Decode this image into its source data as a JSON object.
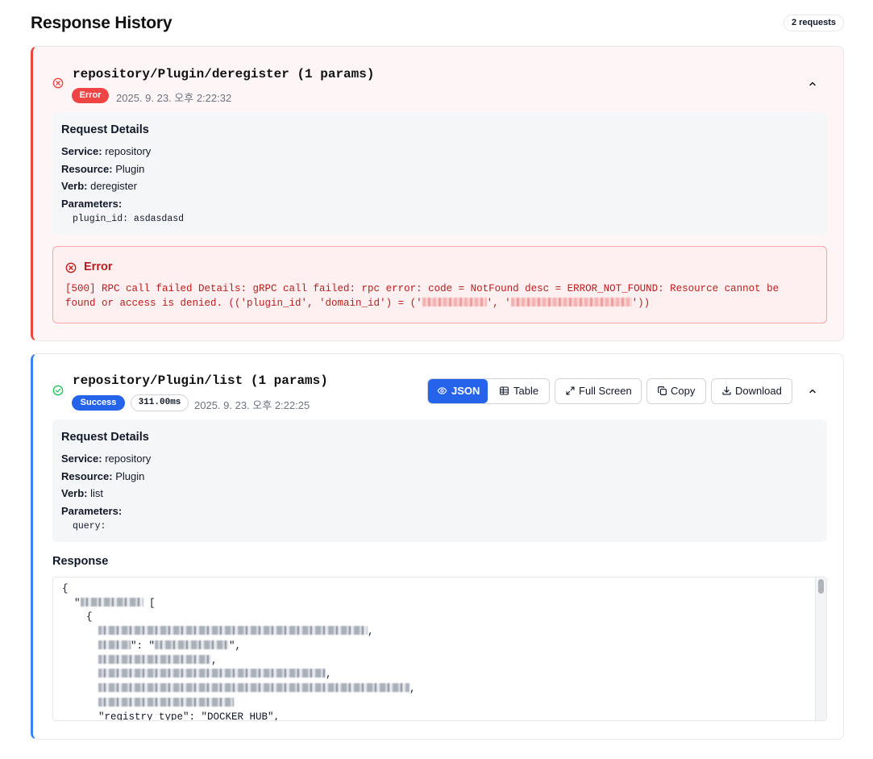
{
  "page": {
    "title": "Response History",
    "request_count": "2 requests"
  },
  "colors": {
    "error": "#ef4444",
    "success": "#2563eb",
    "error_text": "#b91c1c"
  },
  "requests": [
    {
      "title": "repository/Plugin/deregister (1 params)",
      "status": "Error",
      "timestamp": "2025. 9. 23. 오후 2:22:32",
      "details": {
        "heading": "Request Details",
        "service_label": "Service:",
        "service": "repository",
        "resource_label": "Resource:",
        "resource": "Plugin",
        "verb_label": "Verb:",
        "verb": "deregister",
        "parameters_label": "Parameters:",
        "param_key": "plugin_id:",
        "param_value": "asdasdasd"
      },
      "error": {
        "title": "Error",
        "message_part1": "[500] RPC call failed Details: gRPC call failed: rpc error: code = NotFound desc = ERROR_NOT_FOUND: Resource cannot be found or access is denied. (('plugin_id', 'domain_id') = ('",
        "message_sep": "', '",
        "message_end": "'))"
      }
    },
    {
      "title": "repository/Plugin/list (1 params)",
      "status": "Success",
      "duration": "311.00ms",
      "timestamp": "2025. 9. 23. 오후 2:22:25",
      "toolbar": {
        "json_label": "JSON",
        "table_label": "Table",
        "fullscreen_label": "Full Screen",
        "copy_label": "Copy",
        "download_label": "Download"
      },
      "details": {
        "heading": "Request Details",
        "service_label": "Service:",
        "service": "repository",
        "resource_label": "Resource:",
        "resource": "Plugin",
        "verb_label": "Verb:",
        "verb": "list",
        "parameters_label": "Parameters:",
        "param_key": "query:"
      },
      "response": {
        "label": "Response",
        "line_open": "{",
        "line_results_tail": " [",
        "line_item_open": "{",
        "line_name_value_tail": "\": \"",
        "line_last": "\"registry_type\": \"DOCKER_HUB\","
      }
    }
  ]
}
